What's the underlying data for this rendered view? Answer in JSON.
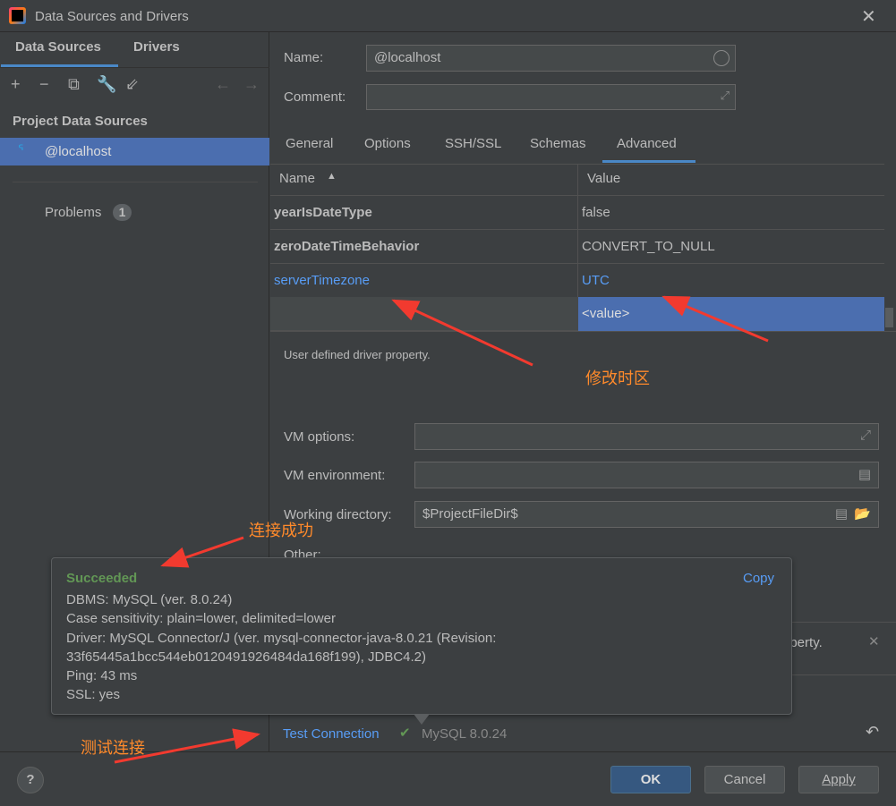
{
  "window": {
    "title": "Data Sources and Drivers",
    "close_icon": "close-icon"
  },
  "left": {
    "tabs": [
      "Data Sources",
      "Drivers"
    ],
    "section": "Project Data Sources",
    "item": "@localhost",
    "problems_label": "Problems",
    "problems_count": "1"
  },
  "form": {
    "name_label": "Name:",
    "name_value": "@localhost",
    "comment_label": "Comment:",
    "comment_value": ""
  },
  "tabs": [
    "General",
    "Options",
    "SSH/SSL",
    "Schemas",
    "Advanced"
  ],
  "active_tab": "Advanced",
  "table": {
    "headers": [
      "Name",
      "Value"
    ],
    "rows": [
      {
        "name": "yearIsDateType",
        "value": "false"
      },
      {
        "name": "zeroDateTimeBehavior",
        "value": "CONVERT_TO_NULL"
      },
      {
        "name": "serverTimezone",
        "value": "UTC"
      },
      {
        "name": "",
        "value": "<value>"
      }
    ]
  },
  "description": "User defined driver property.",
  "vm": {
    "options_label": "VM options:",
    "env_label": "VM environment:",
    "workdir_label": "Working directory:",
    "workdir_value": "$ProjectFileDir$",
    "other_label": "Other:"
  },
  "notice_fragment": "operty.",
  "popup": {
    "title": "Succeeded",
    "copy": "Copy",
    "lines": [
      "DBMS: MySQL (ver. 8.0.24)",
      "Case sensitivity: plain=lower, delimited=lower",
      "Driver: MySQL Connector/J (ver. mysql-connector-java-8.0.21 (Revision:",
      "33f65445a1bcc544eb0120491926484da168f199), JDBC4.2)",
      "Ping: 43 ms",
      "SSL: yes"
    ]
  },
  "status": {
    "test_connection": "Test Connection",
    "version": "MySQL 8.0.24"
  },
  "buttons": {
    "ok": "OK",
    "cancel": "Cancel",
    "apply": "Apply",
    "help": "?"
  },
  "annotations": {
    "timezone": "修改时区",
    "success": "连接成功",
    "test": "测试连接"
  },
  "colors": {
    "accent": "#4b6eaf",
    "link": "#589df6",
    "success": "#629755",
    "annotation": "#ff8a2b",
    "arrow": "#f23a2f"
  }
}
